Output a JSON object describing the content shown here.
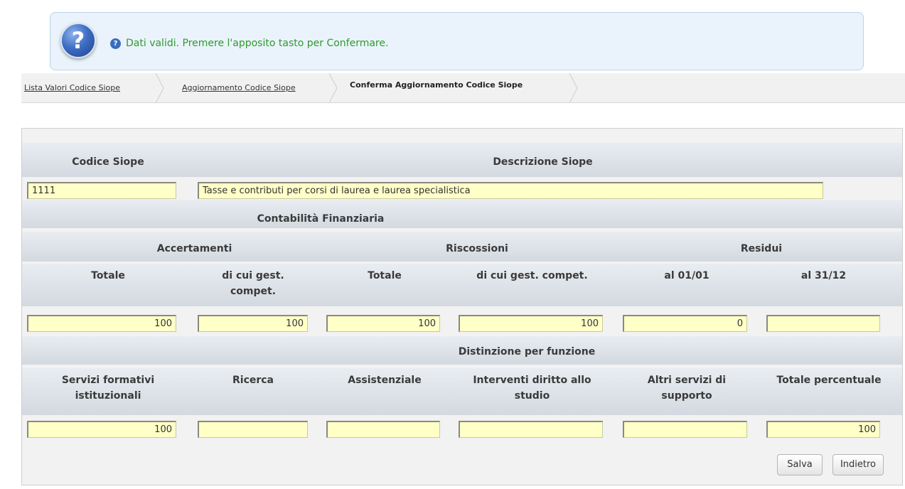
{
  "message": {
    "big_icon": "question-circle-icon",
    "small_icon": "info-question-icon",
    "text": "Dati validi. Premere l'apposito tasto per Confermare."
  },
  "breadcrumb": [
    {
      "label": "Lista Valori Codice Siope"
    },
    {
      "label": "Aggiornamento Codice Siope"
    },
    {
      "label": "Conferma Aggiornamento Codice Siope"
    }
  ],
  "form": {
    "codice_label": "Codice Siope",
    "descrizione_label": "Descrizione Siope",
    "codice_value": "1111",
    "descrizione_value": "Tasse e contributi per corsi di laurea e laurea specialistica",
    "contabilita_label": "Contabilità Finanziaria",
    "groups": {
      "accertamenti": "Accertamenti",
      "riscossioni": "Riscossioni",
      "residui": "Residui"
    },
    "cols1": [
      "Totale",
      "di cui gest.\ncompet.",
      "Totale",
      "di cui gest. compet.",
      "al 01/01",
      "al 31/12"
    ],
    "values1": [
      "100",
      "100",
      "100",
      "100",
      "0",
      ""
    ],
    "distinzione_label": "Distinzione per funzione",
    "cols2": [
      "Servizi formativi\nistituzionali",
      "Ricerca",
      "Assistenziale",
      "Interventi diritto allo\nstudio",
      "Altri servizi di\nsupporto",
      "Totale percentuale"
    ],
    "values2": [
      "100",
      "",
      "",
      "",
      "",
      "100"
    ]
  },
  "buttons": {
    "save": "Salva",
    "back": "Indietro"
  },
  "colors": {
    "accent_green": "#2f9a2f",
    "input_bg": "#ffffc8",
    "message_bg": "#eaf3fb"
  }
}
